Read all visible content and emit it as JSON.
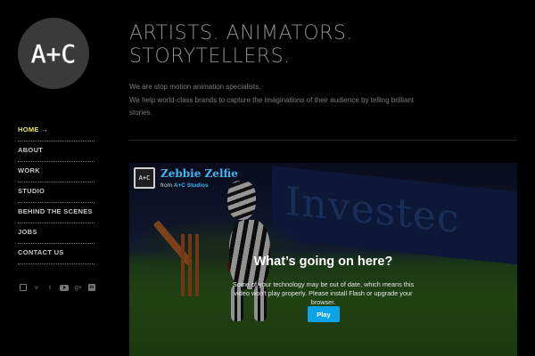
{
  "logo": {
    "text": "A+C"
  },
  "nav": {
    "items": [
      {
        "label": "HOME →",
        "active": true
      },
      {
        "label": "ABOUT"
      },
      {
        "label": "WORK"
      },
      {
        "label": "STUDIO"
      },
      {
        "label": "BEHIND THE SCENES"
      },
      {
        "label": "JOBS"
      },
      {
        "label": "CONTACT US"
      }
    ]
  },
  "social": {
    "icons": [
      "instagram-icon",
      "vimeo-icon",
      "twitter-icon",
      "youtube-icon",
      "google-plus-icon",
      "linkedin-icon"
    ],
    "glyphs": {
      "vimeo": "v",
      "twitter": "t",
      "gplus": "g+",
      "linkedin": "in"
    }
  },
  "header": {
    "headline_line1": "ARTISTS. ANIMATORS.",
    "headline_line2": "STORYTELLERS.",
    "intro_line1": "We are stop motion animation specialists.",
    "intro_line2": "We help world-class brands to capture the imaginations of their audience by telling brilliant stories."
  },
  "video": {
    "thumb_text": "A+C",
    "title": "Zebbie Zelfie",
    "from_label": "from",
    "from_name": "A+C Studios",
    "banner_text": "Investec",
    "message_title": "What’s going on here?",
    "message_body": "Some of your technology may be out of date, which means this video won't play properly. Please install Flash or upgrade your browser.",
    "play_label": "Play"
  },
  "colors": {
    "accent": "#e8e86a",
    "link": "#3fb5f0",
    "button": "#0da3e8"
  }
}
